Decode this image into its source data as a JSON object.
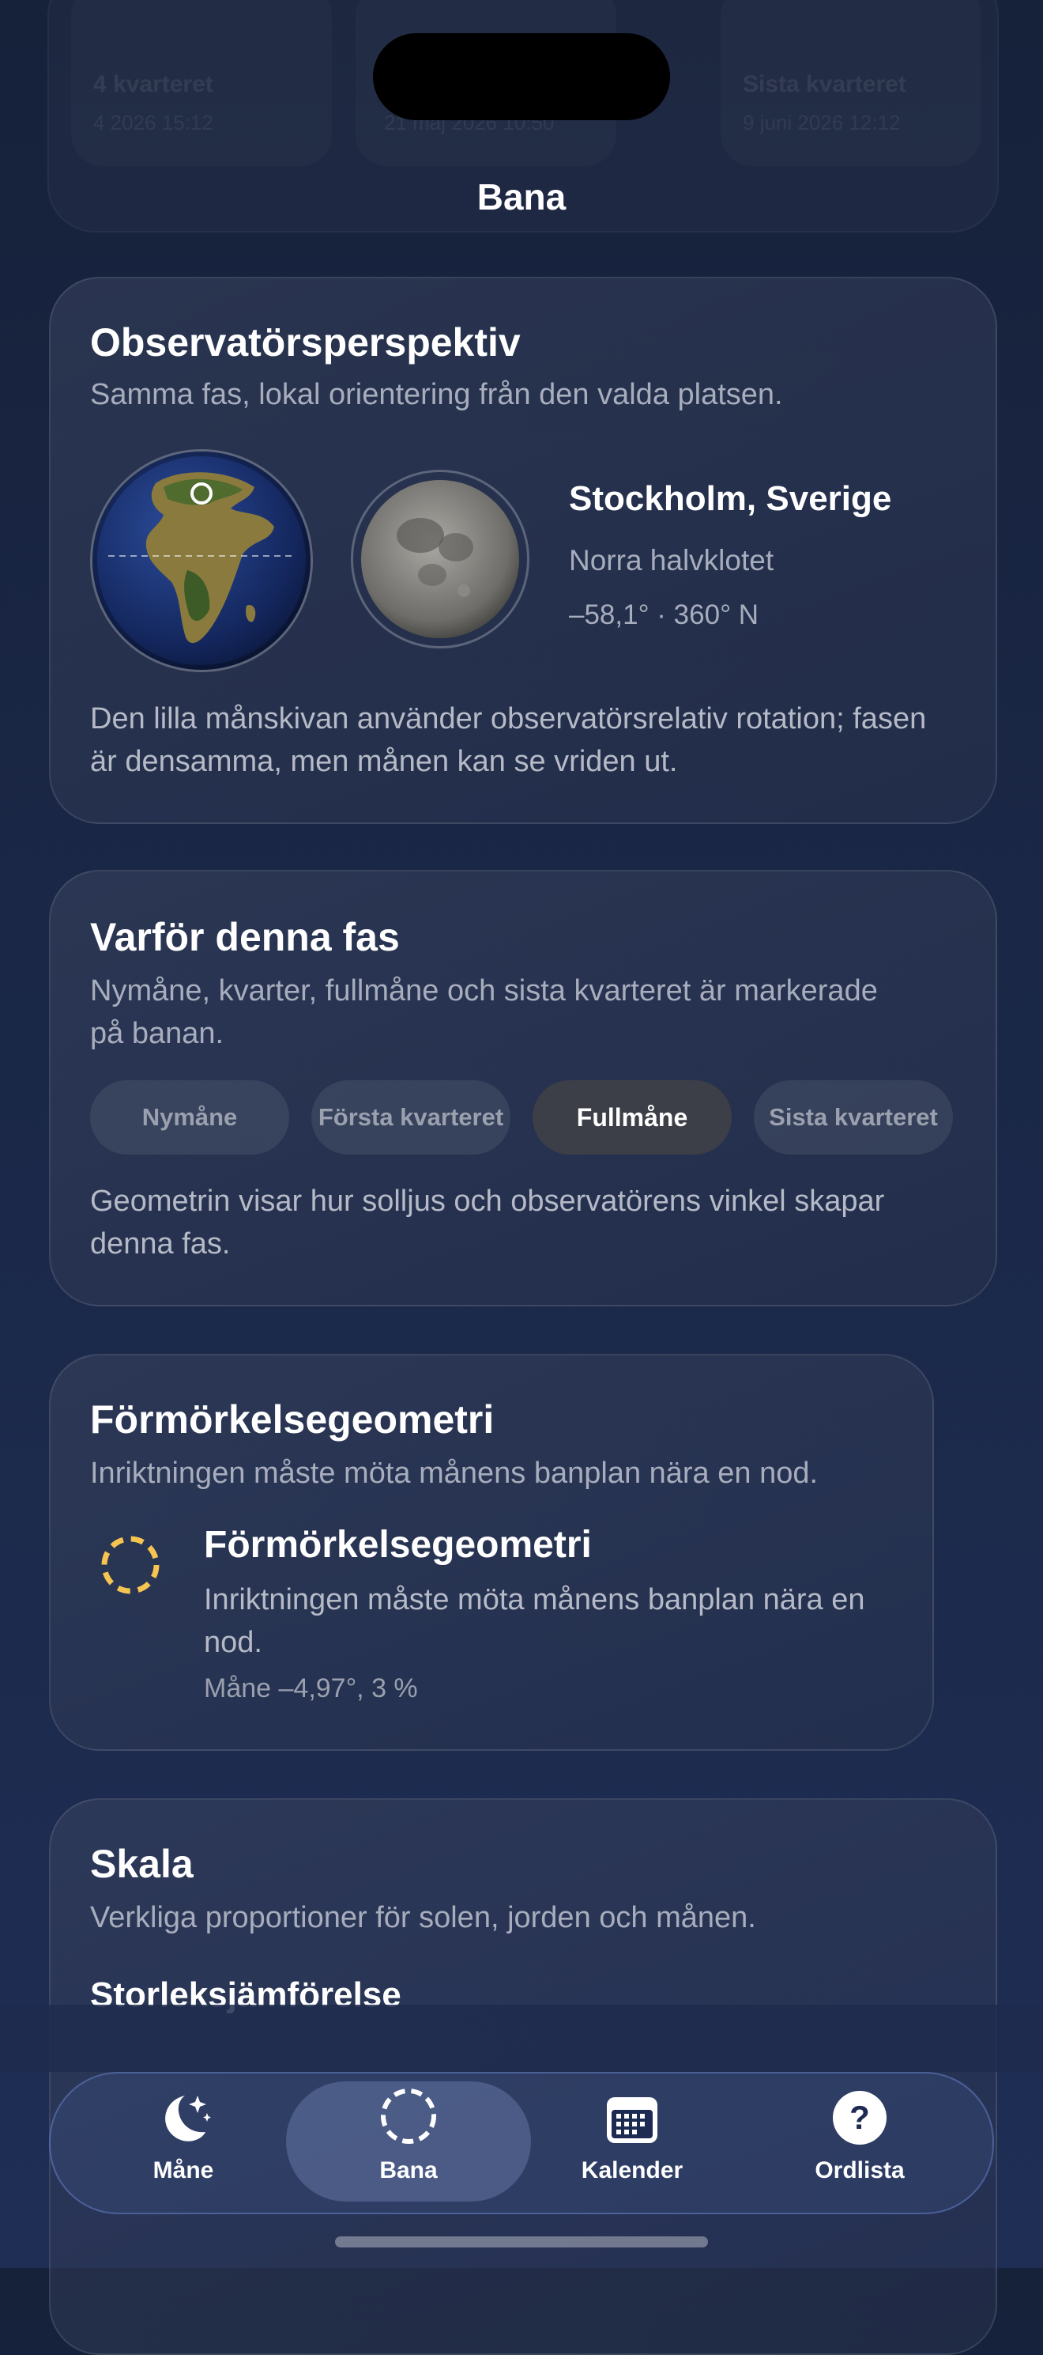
{
  "top_ghost": {
    "items": [
      {
        "title": "4 kvarteret",
        "sub": "4 2026 15:12"
      },
      {
        "title": "",
        "sub": "21 maj 2026 10:50"
      },
      {
        "title": "Sista kvarteret",
        "sub": "9 juni 2026 12:12"
      }
    ]
  },
  "nav": {
    "title": "Bana"
  },
  "observer": {
    "title": "Observatörsperspektiv",
    "subtitle": "Samma fas, lokal orientering från den valda platsen.",
    "location": "Stockholm, Sverige",
    "hemisphere": "Norra halvklotet",
    "coords": "–58,1° · 360° N",
    "note": "Den lilla månskivan använder observatörsrelativ rotation; fasen är densamma, men månen kan se vriden ut."
  },
  "phase": {
    "title": "Varför denna fas",
    "subtitle": "Nymåne, kvarter, fullmåne och sista kvarteret är markerade på banan.",
    "chips": [
      "Nymåne",
      "Första kvarteret",
      "Fullmåne",
      "Sista kvarteret"
    ],
    "active_chip": "Fullmåne",
    "note": "Geometrin visar hur solljus och observatörens vinkel skapar denna fas."
  },
  "eclipse": {
    "title": "Förmörkelsegeometri",
    "subtitle": "Inriktningen måste möta månens banplan nära en nod.",
    "item_title": "Förmörkelsegeometri",
    "item_desc": "Inriktningen måste möta månens banplan nära en nod.",
    "item_meta": "Måne –4,97°, 3 %",
    "icon": "dashed-circle-icon",
    "accent": "#f5c451"
  },
  "scale": {
    "title": "Skala",
    "subtitle": "Verkliga proportioner för solen, jorden och månen.",
    "section": "Storleksjämförelse"
  },
  "tabs": [
    {
      "label": "Måne",
      "icon": "moon-stars-icon"
    },
    {
      "label": "Bana",
      "icon": "orbit-icon",
      "active": true
    },
    {
      "label": "Kalender",
      "icon": "calendar-icon"
    },
    {
      "label": "Ordlista",
      "icon": "question-icon"
    }
  ]
}
